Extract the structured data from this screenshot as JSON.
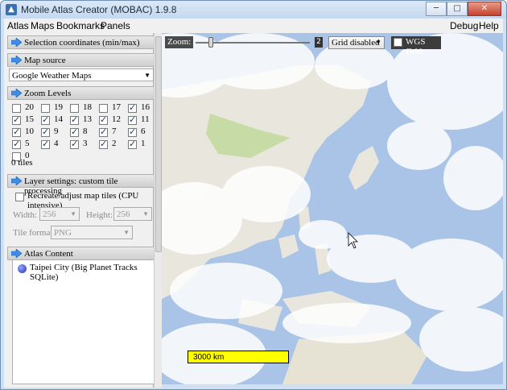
{
  "window": {
    "title": "Mobile Atlas Creator (MOBAC) 1.9.8",
    "minimize": "─",
    "maximize": "□",
    "close": "✕"
  },
  "menu": {
    "atlas": "Atlas",
    "maps": "Maps",
    "bookmarks": "Bookmarks",
    "panels": "Panels",
    "debug": "Debug",
    "help": "Help"
  },
  "panel": {
    "selection_header": "Selection coordinates (min/max)",
    "map_source_header": "Map source",
    "map_source_value": "Google Weather Maps",
    "zoom_header": "Zoom Levels",
    "zoom_levels": [
      {
        "label": "20",
        "checked": false
      },
      {
        "label": "19",
        "checked": false
      },
      {
        "label": "18",
        "checked": false
      },
      {
        "label": "17",
        "checked": false
      },
      {
        "label": "16",
        "checked": true
      },
      {
        "label": "15",
        "checked": true
      },
      {
        "label": "14",
        "checked": true
      },
      {
        "label": "13",
        "checked": true
      },
      {
        "label": "12",
        "checked": true
      },
      {
        "label": "11",
        "checked": true
      },
      {
        "label": "10",
        "checked": true
      },
      {
        "label": "9",
        "checked": true
      },
      {
        "label": "8",
        "checked": true
      },
      {
        "label": "7",
        "checked": true
      },
      {
        "label": "6",
        "checked": true
      },
      {
        "label": "5",
        "checked": true
      },
      {
        "label": "4",
        "checked": true
      },
      {
        "label": "3",
        "checked": true
      },
      {
        "label": "2",
        "checked": true
      },
      {
        "label": "1",
        "checked": true
      },
      {
        "label": "0",
        "checked": false
      }
    ],
    "tiles_count": "0 tiles",
    "layer_header": "Layer settings: custom tile processing",
    "recreate_label": "Recreate/adjust map tiles (CPU intensive)",
    "width_label": "Width:",
    "width_value": "256",
    "height_label": "Height:",
    "height_value": "256",
    "tile_format_label": "Tile format:",
    "tile_format_value": "PNG",
    "atlas_content_header": "Atlas Content",
    "atlas_item": "Taipei City (Big Planet Tracks SQLite)"
  },
  "map": {
    "zoom_label": "Zoom:",
    "zoom_value": "2",
    "zoom_level": 2,
    "grid_value": "Grid disabled",
    "wgs_label": "WGS Grid:",
    "scale_text": "3000 km"
  },
  "colors": {
    "accent": "#3a6fb0",
    "scale_bar": "#ffff00",
    "ocean": "#a8c3e4"
  }
}
